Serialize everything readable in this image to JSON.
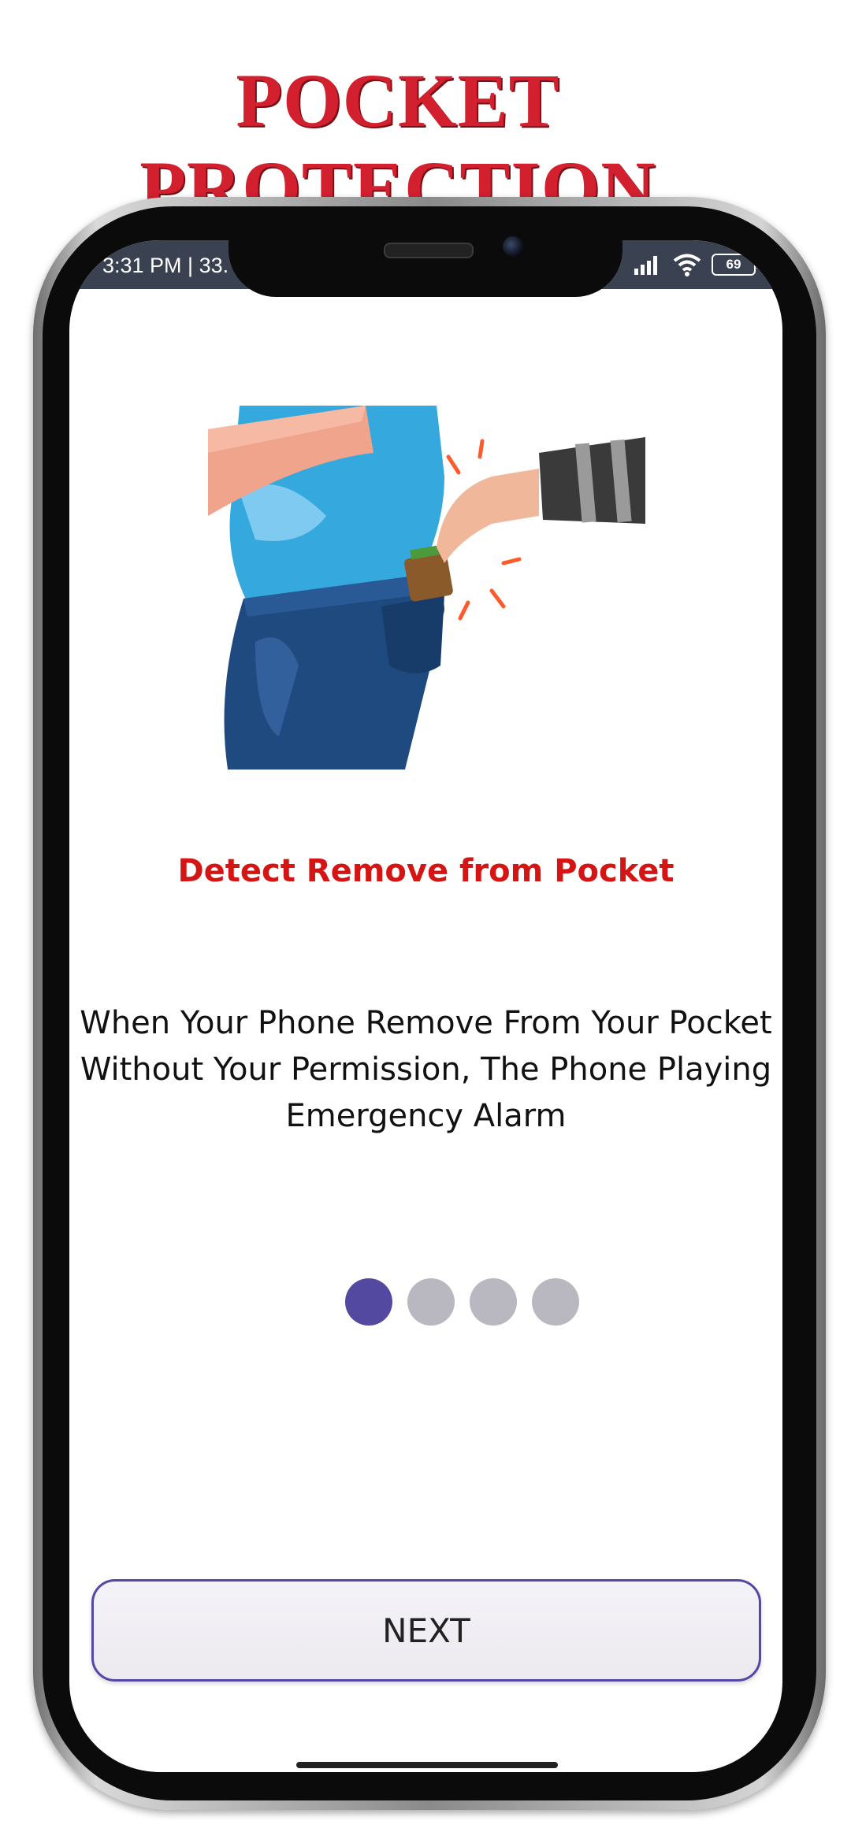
{
  "promo": {
    "title": "POCKET PROTECTION"
  },
  "status_bar": {
    "time": "3:31 PM | 33.",
    "battery": "69"
  },
  "onboarding": {
    "heading": "Detect Remove from Pocket",
    "description": "When Your Phone Remove From Your Pocket Without Your Permission, The Phone Playing Emergency Alarm",
    "page_count": 4,
    "active_page": 1,
    "next_label": "NEXT"
  },
  "colors": {
    "promo_title": "#d2202f",
    "heading": "#d51414",
    "accent": "#5449a0",
    "inactive_dot": "#b9b8c0",
    "status_bar": "#3a4151"
  },
  "icons": [
    "signal-icon",
    "wifi-icon",
    "battery-icon"
  ]
}
